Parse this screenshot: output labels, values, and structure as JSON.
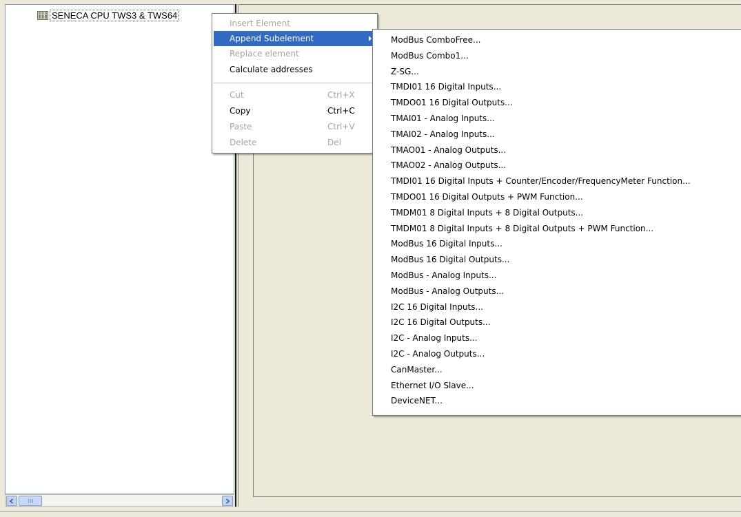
{
  "tree": {
    "root_label": "SENECA CPU TWS3 & TWS64"
  },
  "context_menu": {
    "items": [
      {
        "label": "Insert Element",
        "shortcut": "",
        "disabled": true,
        "selected": false,
        "submenu": false
      },
      {
        "label": "Append Subelement",
        "shortcut": "",
        "disabled": false,
        "selected": true,
        "submenu": true
      },
      {
        "label": "Replace element",
        "shortcut": "",
        "disabled": true,
        "selected": false,
        "submenu": false
      },
      {
        "label": "Calculate addresses",
        "shortcut": "",
        "disabled": false,
        "selected": false,
        "submenu": false
      },
      {
        "label": "Cut",
        "shortcut": "Ctrl+X",
        "disabled": true,
        "selected": false,
        "submenu": false
      },
      {
        "label": "Copy",
        "shortcut": "Ctrl+C",
        "disabled": false,
        "selected": false,
        "submenu": false
      },
      {
        "label": "Paste",
        "shortcut": "Ctrl+V",
        "disabled": true,
        "selected": false,
        "submenu": false
      },
      {
        "label": "Delete",
        "shortcut": "Del",
        "disabled": true,
        "selected": false,
        "submenu": false
      }
    ]
  },
  "submenu": {
    "items": [
      "ModBus ComboFree...",
      "ModBus Combo1...",
      "Z-SG...",
      "TMDI01 16 Digital Inputs...",
      "TMDO01 16 Digital Outputs...",
      "TMAI01 - Analog Inputs...",
      "TMAI02 - Analog Inputs...",
      "TMAO01 - Analog Outputs...",
      "TMAO02 - Analog Outputs...",
      "TMDI01 16 Digital Inputs + Counter/Encoder/FrequencyMeter Function...",
      "TMDO01 16 Digital Outputs + PWM Function...",
      "TMDM01 8 Digital Inputs + 8 Digital Outputs...",
      "TMDM01 8 Digital Inputs + 8 Digital Outputs + PWM Function...",
      "ModBus 16 Digital Inputs...",
      "ModBus 16 Digital Outputs...",
      "ModBus - Analog Inputs...",
      "ModBus - Analog Outputs...",
      "I2C 16 Digital Inputs...",
      "I2C 16 Digital Outputs...",
      "I2C - Analog Inputs...",
      "I2C - Analog Outputs...",
      "CanMaster...",
      "Ethernet I/O Slave...",
      "DeviceNET..."
    ]
  },
  "icons": {
    "tree_node": "module-icon",
    "scroll_left": "arrow-left-icon",
    "scroll_right": "arrow-right-icon",
    "submenu_arrow": "submenu-arrow-icon"
  },
  "colors": {
    "selection": "#316ac5",
    "disabled_text": "#a7a69a",
    "window_bg": "#ece9d8"
  }
}
